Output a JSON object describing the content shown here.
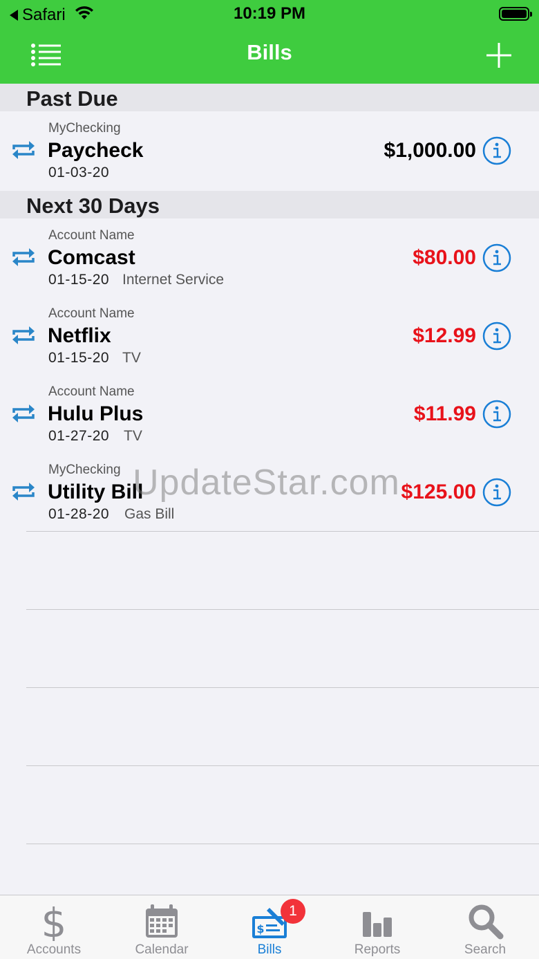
{
  "status_bar": {
    "back_label": "Safari",
    "time": "10:19 PM"
  },
  "nav": {
    "title": "Bills"
  },
  "sections": [
    {
      "title": "Past Due",
      "rows": [
        {
          "account": "MyChecking",
          "name": "Paycheck",
          "date": "01-03-20",
          "note": "",
          "amount": "$1,000.00",
          "amount_color": "#000000"
        }
      ]
    },
    {
      "title": "Next 30 Days",
      "rows": [
        {
          "account": "Account Name",
          "name": "Comcast",
          "date": "01-15-20",
          "note": "Internet Service",
          "amount": "$80.00",
          "amount_color": "#e8121a"
        },
        {
          "account": "Account Name",
          "name": "Netflix",
          "date": "01-15-20",
          "note": "TV",
          "amount": "$12.99",
          "amount_color": "#e8121a"
        },
        {
          "account": "Account Name",
          "name": "Hulu Plus",
          "date": "01-27-20",
          "note": "TV",
          "amount": "$11.99",
          "amount_color": "#e8121a"
        },
        {
          "account": "MyChecking",
          "name": "Utility Bill",
          "date": "01-28-20",
          "note": "Gas Bill",
          "amount": "$125.00",
          "amount_color": "#e8121a"
        }
      ]
    }
  ],
  "watermark": "UpdateStar.com",
  "tabbar": {
    "tabs": [
      {
        "label": "Accounts",
        "icon": "dollar-icon"
      },
      {
        "label": "Calendar",
        "icon": "calendar-icon"
      },
      {
        "label": "Bills",
        "icon": "check-icon",
        "active": true
      },
      {
        "label": "Reports",
        "icon": "bar-chart-icon"
      },
      {
        "label": "Search",
        "icon": "magnifier-icon"
      }
    ],
    "bills_badge": "1"
  },
  "colors": {
    "header_green": "#3fcc3f",
    "accent_blue": "#1a7fd6",
    "overdue_red": "#e8121a",
    "badge_red": "#f2333a"
  }
}
